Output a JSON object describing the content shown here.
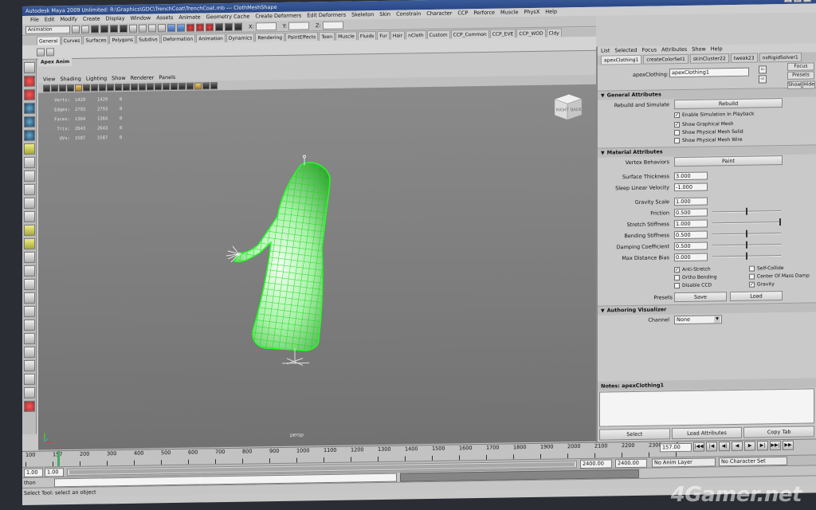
{
  "window": {
    "title": "Autodesk Maya 2009 Unlimited: R:\\Graphics\\GDC\\TrenchCoat\\TrenchCoat.mb  ---  ClothMeshShape",
    "buttons": [
      "_",
      "□",
      "×"
    ]
  },
  "menu": [
    "File",
    "Edit",
    "Modify",
    "Create",
    "Display",
    "Window",
    "Assets",
    "Animate",
    "Geometry Cache",
    "Create Deformers",
    "Edit Deformers",
    "Skeleton",
    "Skin",
    "Constrain",
    "Character",
    "CCP",
    "Perforce",
    "Muscle",
    "PhysX",
    "Help"
  ],
  "status": {
    "mode": "Animation",
    "coord_x": "X:",
    "coord_y": "Y:",
    "coord_z": "Z:"
  },
  "shelf": {
    "tabs": [
      "General",
      "Curves",
      "Surfaces",
      "Polygons",
      "Subdivs",
      "Deformation",
      "Animation",
      "Dynamics",
      "Rendering",
      "PaintEffects",
      "Toon",
      "Muscle",
      "Fluids",
      "Fur",
      "Hair",
      "nCloth",
      "Custom",
      "CCP_Common",
      "CCP_EVE",
      "CCP_WOD",
      "Cldy"
    ],
    "active_index": 0,
    "title": "Apex Anim"
  },
  "panel_menu": [
    "View",
    "Shading",
    "Lighting",
    "Show",
    "Renderer",
    "Panels"
  ],
  "hud": [
    {
      "label": "Verts:",
      "v1": "1429",
      "v2": "1429",
      "v3": "0"
    },
    {
      "label": "Edges:",
      "v1": "2793",
      "v2": "2793",
      "v3": "0"
    },
    {
      "label": "Faces:",
      "v1": "1364",
      "v2": "1364",
      "v3": "0"
    },
    {
      "label": "Tris:",
      "v1": "2643",
      "v2": "2643",
      "v3": "0"
    },
    {
      "label": "UVs:",
      "v1": "1587",
      "v2": "1587",
      "v3": "0"
    }
  ],
  "viewcube": {
    "right": "RIGHT",
    "back": "BACK"
  },
  "camera_label": "persp",
  "attr_editor": {
    "menu": [
      "List",
      "Selected",
      "Focus",
      "Attributes",
      "Show",
      "Help"
    ],
    "tabs": [
      "apexClothing1",
      "createColorSet1",
      "skinCluster22",
      "tweak23",
      "nxRigidSolver1"
    ],
    "active_tab": 0,
    "node_label": "apexClothing:",
    "node_value": "apexClothing1",
    "side_buttons": [
      "Focus",
      "Presets",
      "Show",
      "Hide"
    ],
    "general": {
      "title": "General Attributes",
      "rebuild_label": "Rebuild and Simulate",
      "rebuild_button": "Rebuild",
      "enable_sim": "Enable Simulation In Playback",
      "show_graphical": "Show Graphical Mesh",
      "show_physical_solid": "Show Physical Mesh Solid",
      "show_physical_wire": "Show Physical Mesh Wire"
    },
    "material": {
      "title": "Material Attributes",
      "vertex_label": "Vertex Behaviors",
      "paint_button": "Paint",
      "surface_thickness": {
        "label": "Surface Thickness",
        "value": "3.000"
      },
      "sleep_velocity": {
        "label": "Sleep Linear Velocity",
        "value": "-1.000"
      },
      "gravity_scale": {
        "label": "Gravity Scale",
        "value": "1.000"
      },
      "friction": {
        "label": "Friction",
        "value": "0.500",
        "level": 0.5
      },
      "stretch": {
        "label": "Stretch Stiffness",
        "value": "1.000",
        "level": 1.0
      },
      "bending": {
        "label": "Bending Stiffness",
        "value": "0.500",
        "level": 0.5
      },
      "damping": {
        "label": "Damping Coefficient",
        "value": "0.500",
        "level": 0.5
      },
      "max_distance": {
        "label": "Max Distance Bias",
        "value": "0.000",
        "level": 0.5
      },
      "anti_stretch": "Anti-Stretch",
      "self_collide": "Self-Collide",
      "ortho_bending": "Ortho Bending",
      "center_mass": "Center Of Mass Damp",
      "disable_ccd": "Disable CCD",
      "gravity": "Gravity",
      "presets_label": "Presets",
      "save_button": "Save",
      "load_button": "Load"
    },
    "authoring": {
      "title": "Authoring Visualizer",
      "channel_label": "Channel",
      "channel_value": "None"
    },
    "notes_title": "Notes:  apexClothing1",
    "bottom_buttons": [
      "Select",
      "Load Attributes",
      "Copy Tab"
    ]
  },
  "timeline": {
    "ticks": [
      "100",
      "157",
      "200",
      "300",
      "400",
      "500",
      "600",
      "700",
      "800",
      "900",
      "1000",
      "1100",
      "1200",
      "1300",
      "1400",
      "1500",
      "1600",
      "1700",
      "1800",
      "1900",
      "2000",
      "2100",
      "2200",
      "2300",
      "2"
    ],
    "current_frame": "157.00",
    "play_buttons": [
      "|◀◀",
      "|◀",
      "◀|",
      "◀",
      "▶",
      "▶|",
      "▶▶|",
      "▶▶"
    ]
  },
  "range": {
    "start": "1.00",
    "start2": "1.00",
    "end": "2400.00",
    "end2": "2400.00",
    "anim_layer": "No Anim Layer",
    "character_set": "No Character Set"
  },
  "cmd": {
    "label": "thon"
  },
  "help_line": "Select Tool: select an object",
  "watermark": "4Gamer.net"
}
